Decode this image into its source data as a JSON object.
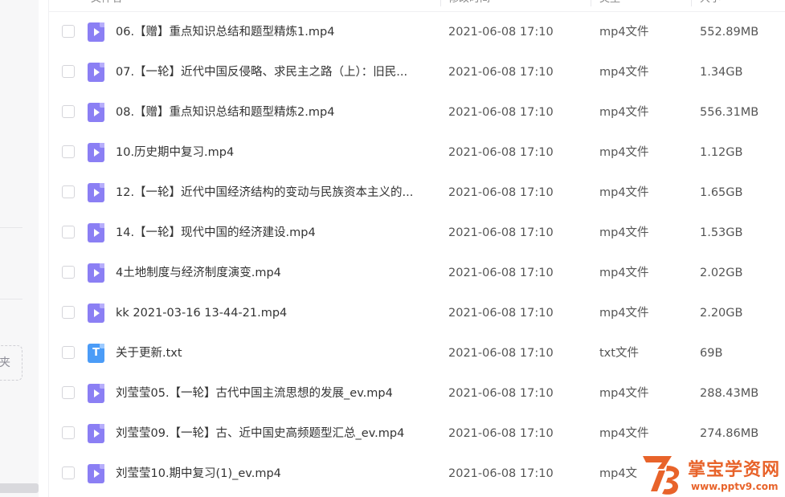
{
  "header": {
    "col_name": "文件名",
    "col_modified": "修改时间",
    "col_type": "类型",
    "col_size": "大小"
  },
  "sidebar": {
    "new_folder_label": "夹"
  },
  "files": [
    {
      "name": "06.【赠】重点知识总结和题型精炼1.mp4",
      "modified": "2021-06-08 17:10",
      "type": "mp4文件",
      "size": "552.89MB",
      "icon": "video-file-icon"
    },
    {
      "name": "07.【一轮】近代中国反侵略、求民主之路（上）：旧民...",
      "modified": "2021-06-08 17:10",
      "type": "mp4文件",
      "size": "1.34GB",
      "icon": "video-file-icon"
    },
    {
      "name": "08.【赠】重点知识总结和题型精炼2.mp4",
      "modified": "2021-06-08 17:10",
      "type": "mp4文件",
      "size": "556.31MB",
      "icon": "video-file-icon"
    },
    {
      "name": "10.历史期中复习.mp4",
      "modified": "2021-06-08 17:10",
      "type": "mp4文件",
      "size": "1.12GB",
      "icon": "video-file-icon"
    },
    {
      "name": "12.【一轮】近代中国经济结构的变动与民族资本主义的...",
      "modified": "2021-06-08 17:10",
      "type": "mp4文件",
      "size": "1.65GB",
      "icon": "video-file-icon"
    },
    {
      "name": "14.【一轮】现代中国的经济建设.mp4",
      "modified": "2021-06-08 17:10",
      "type": "mp4文件",
      "size": "1.53GB",
      "icon": "video-file-icon"
    },
    {
      "name": "4土地制度与经济制度演变.mp4",
      "modified": "2021-06-08 17:10",
      "type": "mp4文件",
      "size": "2.02GB",
      "icon": "video-file-icon"
    },
    {
      "name": "kk 2021-03-16 13-44-21.mp4",
      "modified": "2021-06-08 17:10",
      "type": "mp4文件",
      "size": "2.20GB",
      "icon": "video-file-icon"
    },
    {
      "name": "关于更新.txt",
      "modified": "2021-06-08 17:10",
      "type": "txt文件",
      "size": "69B",
      "icon": "text-file-icon",
      "icon_letter": "T"
    },
    {
      "name": "刘莹莹05.【一轮】古代中国主流思想的发展_ev.mp4",
      "modified": "2021-06-08 17:10",
      "type": "mp4文件",
      "size": "288.43MB",
      "icon": "video-file-icon"
    },
    {
      "name": "刘莹莹09.【一轮】古、近中国史高频题型汇总_ev.mp4",
      "modified": "2021-06-08 17:10",
      "type": "mp4文件",
      "size": "274.86MB",
      "icon": "video-file-icon"
    },
    {
      "name": "刘莹莹10.期中复习(1)_ev.mp4",
      "modified": "2021-06-08 17:10",
      "type": "mp4文",
      "size": "",
      "icon": "video-file-icon"
    }
  ],
  "watermark": {
    "title": "掌宝学资网",
    "url": "www.pptv9.com"
  },
  "colors": {
    "video_icon": "#8b7ff4",
    "text_icon": "#4b9cf7",
    "watermark": "#e8632a"
  }
}
